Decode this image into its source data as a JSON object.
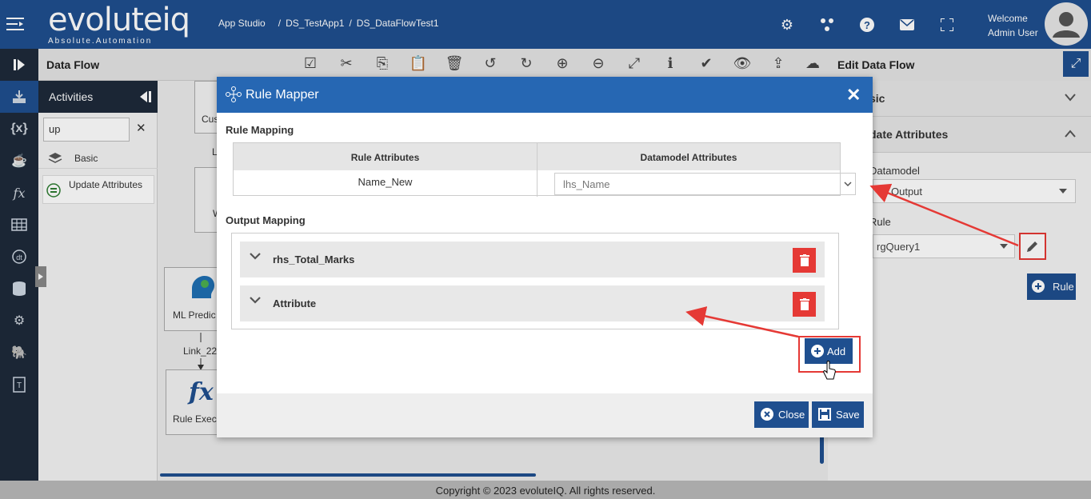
{
  "header": {
    "logo_text": "evoluteiq",
    "logo_tagline": "Absolute.Automation",
    "breadcrumb": [
      "App Studio",
      "/",
      "DS_TestApp1",
      "/",
      "DS_DataFlowTest1"
    ],
    "welcome_line1": "Welcome",
    "welcome_line2": "Admin User",
    "icons": [
      "gear-icon",
      "network-icon",
      "help-icon",
      "mail-icon",
      "fullscreen-icon"
    ]
  },
  "dataflow": {
    "title": "Data Flow",
    "toolbar_icons": [
      "select-icon",
      "cut-icon",
      "copy-icon",
      "paste-icon",
      "delete-icon",
      "undo-icon",
      "redo-icon",
      "zoom-in-icon",
      "zoom-out-icon",
      "fit-icon",
      "info-icon",
      "validate-icon",
      "preview-icon",
      "upload-icon",
      "cloud-upload-icon"
    ]
  },
  "activities": {
    "title": "Activities",
    "search_value": "up",
    "category": "Basic",
    "item": "Update Attributes"
  },
  "canvas": {
    "node1_label": "Cus",
    "node2_label": "W",
    "small_label_L": "L",
    "ml_node": "ML Predic",
    "link_label": "Link_22",
    "rule_node": "Rule Exec"
  },
  "edit_panel": {
    "title": "Edit Data Flow",
    "section_basic": "sic",
    "section_update": "date Attributes",
    "datamodel_label": "Datamodel",
    "datamodel_value": "Output",
    "rule_label": "Rule",
    "rule_value": "rgQuery1",
    "rule_button": "Rule"
  },
  "modal": {
    "title": "Rule Mapper",
    "rule_mapping_label": "Rule Mapping",
    "col_rule_attributes": "Rule Attributes",
    "col_datamodel_attributes": "Datamodel Attributes",
    "row_rule_attr": "Name_New",
    "row_datamodel_attr": "lhs_Name",
    "output_mapping_label": "Output Mapping",
    "output_rows": [
      "rhs_Total_Marks",
      "Attribute"
    ],
    "add_label": "Add",
    "close_label": "Close",
    "save_label": "Save"
  },
  "footer": {
    "copyright": "Copyright © 2023 evoluteIQ. All rights reserved."
  },
  "colors": {
    "primary": "#1f4f8f",
    "modal_header": "#2667b3",
    "danger": "#e53935",
    "sidebar": "#1e2a3a"
  }
}
